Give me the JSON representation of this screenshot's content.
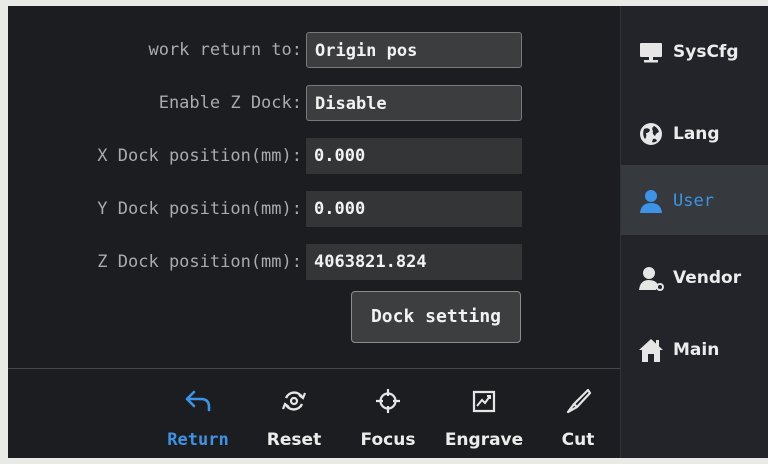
{
  "settings": {
    "work_return": {
      "label": "work return to:",
      "value": "Origin pos"
    },
    "enable_z_dock": {
      "label": "Enable Z Dock:",
      "value": "Disable"
    },
    "x_dock": {
      "label": "X Dock position(mm):",
      "value": "0.000"
    },
    "y_dock": {
      "label": "Y Dock position(mm):",
      "value": "0.000"
    },
    "z_dock": {
      "label": "Z Dock position(mm):",
      "value": "4063821.824"
    },
    "dock_setting_label": "Dock setting"
  },
  "toolbar": {
    "items": [
      {
        "label": "Return",
        "icon": "return-arrow-icon",
        "active": true
      },
      {
        "label": "Reset",
        "icon": "reset-icon"
      },
      {
        "label": "Focus",
        "icon": "crosshair-icon"
      },
      {
        "label": "Engrave",
        "icon": "engrave-icon"
      },
      {
        "label": "Cut",
        "icon": "knife-icon"
      }
    ]
  },
  "sidebar": {
    "items": [
      {
        "label": "SysCfg",
        "icon": "monitor-icon"
      },
      {
        "label": "Lang",
        "icon": "globe-icon"
      },
      {
        "label": "User",
        "icon": "user-icon",
        "active": true
      },
      {
        "label": "Vendor",
        "icon": "vendor-user-icon"
      },
      {
        "label": "Main",
        "icon": "home-icon"
      }
    ]
  },
  "colors": {
    "background": "#1b1d21",
    "active_accent": "#3d94e6",
    "text": "#ececec",
    "label_text": "#a9abae"
  }
}
